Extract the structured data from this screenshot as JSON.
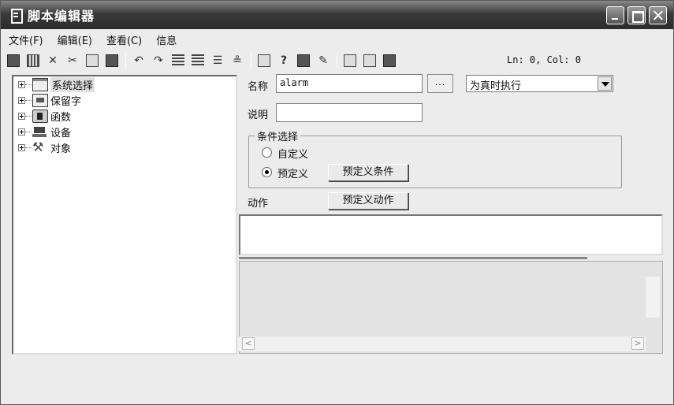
{
  "window": {
    "title": "脚本编辑器"
  },
  "menu": [
    "文件(F)",
    "编辑(E)",
    "查看(C)",
    "信息"
  ],
  "toolbar": {
    "icons": [
      "save-icon",
      "grid-icon",
      "delete-icon",
      "cut-icon",
      "copy-icon",
      "paste-icon",
      "undo-icon",
      "redo-icon",
      "indent-icon",
      "outdent-icon",
      "comment-icon",
      "uncomment-icon",
      "keyboard-icon",
      "help-icon",
      "book-icon",
      "tool-icon",
      "image-icon",
      "edit-icon",
      "clipboard-icon"
    ],
    "status": "Ln: 0, Col: 0"
  },
  "tree": {
    "items": [
      {
        "label": "系统选择",
        "icon": "system-icon",
        "selected": true
      },
      {
        "label": "保留字",
        "icon": "reserved-icon"
      },
      {
        "label": "函数",
        "icon": "function-icon"
      },
      {
        "label": "设备",
        "icon": "device-icon"
      },
      {
        "label": "对象",
        "icon": "object-icon"
      }
    ]
  },
  "form": {
    "name_label": "名称",
    "name_value": "alarm",
    "browse_label": "...",
    "exec_mode": "为真时执行",
    "desc_label": "说明",
    "desc_value": "",
    "condition_group": "条件选择",
    "radio_custom": "自定义",
    "radio_predef": "预定义",
    "predef_condition_btn": "预定义条件",
    "action_label": "动作",
    "predef_action_btn": "预定义动作"
  },
  "colors": {
    "titlebar": "#3a3a3a",
    "face": "#ececec"
  }
}
